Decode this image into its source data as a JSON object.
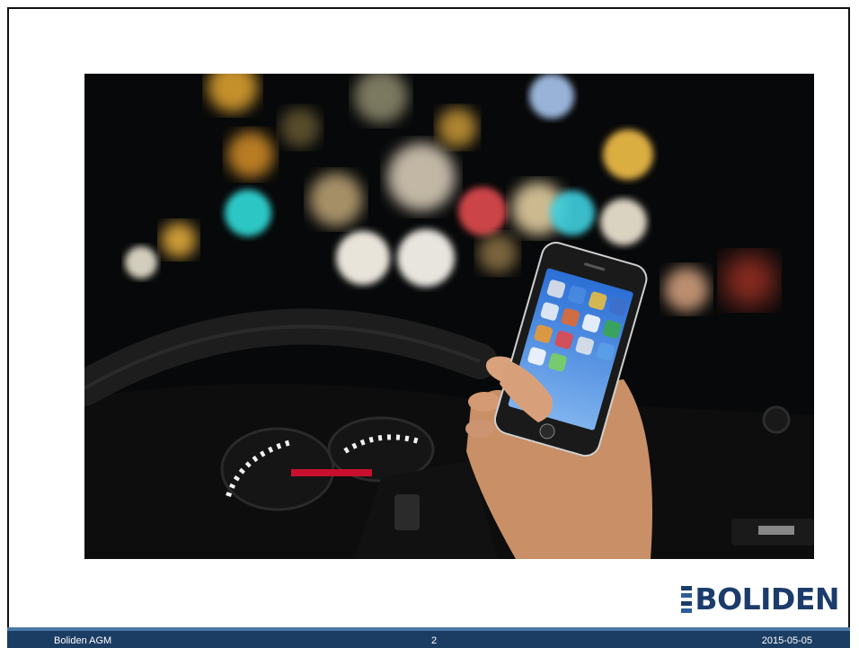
{
  "photo": {
    "subject": "hand-holding-smartphone-while-driving-at-night",
    "colors": {
      "dark": "#070809",
      "bokeh_teal": "#2ec4c4",
      "bokeh_amber": "#f2b84a",
      "bokeh_red": "#e0484c"
    }
  },
  "logo": {
    "text": "BOLIDEN",
    "color": "#1b3c6b"
  },
  "footer": {
    "left": "Boliden AGM",
    "page_number": "2",
    "date": "2015-05-05",
    "bar_color": "#1c3d63"
  }
}
